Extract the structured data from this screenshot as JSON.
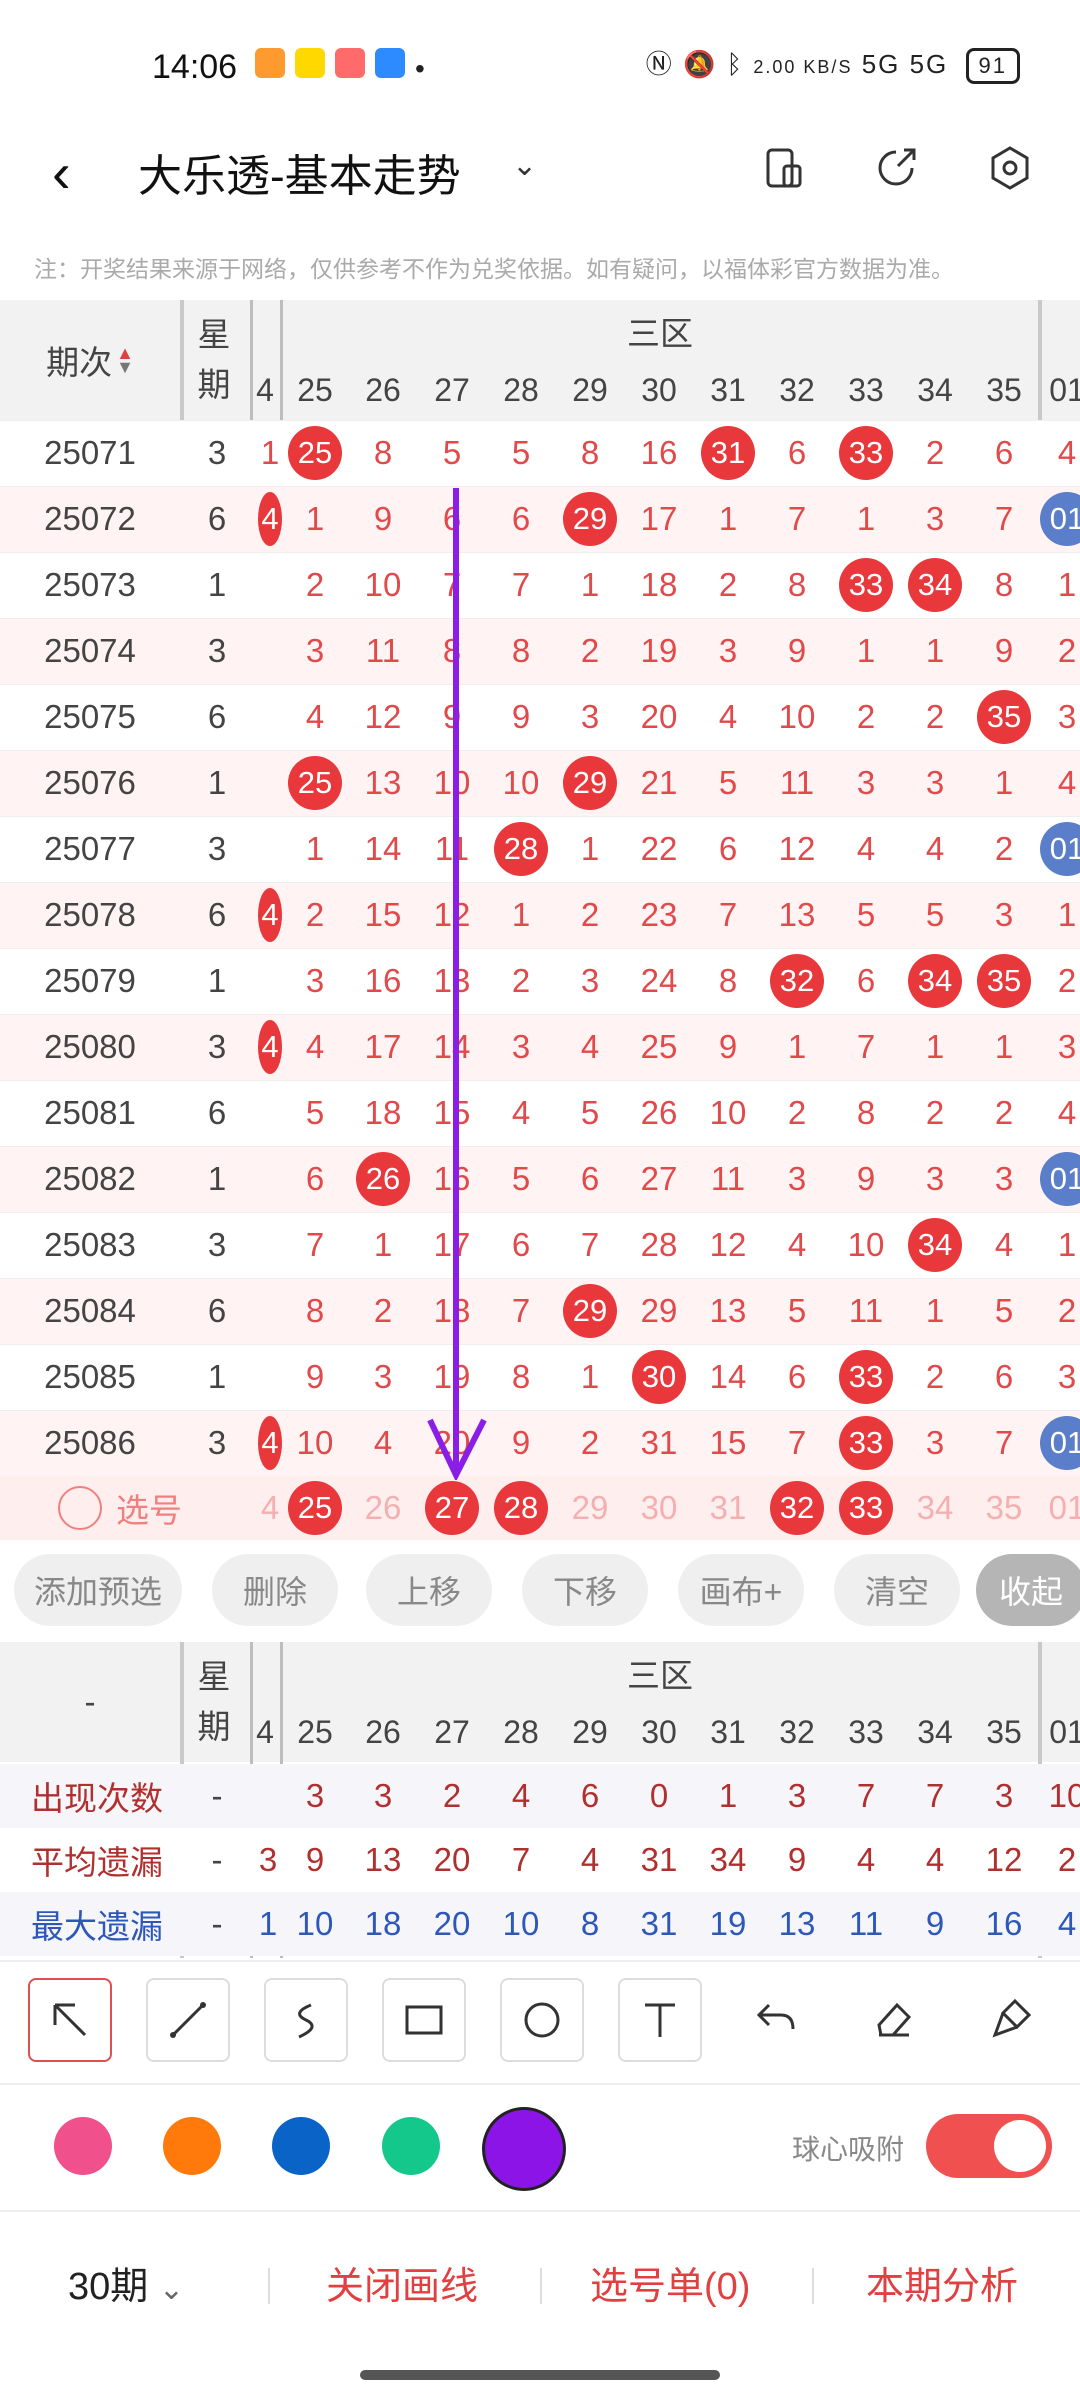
{
  "status": {
    "time": "14:06",
    "net_speed": "2.00 KB/S",
    "signal": "5G 5G",
    "battery": "91"
  },
  "header": {
    "title": "大乐透-基本走势"
  },
  "note": "注：开奖结果来源于网络，仅供参考不作为兑奖依据。如有疑问，以福体彩官方数据为准。",
  "table": {
    "col_issue": "期次",
    "col_week": "星期",
    "zone": "三区",
    "numbers": [
      "4",
      "25",
      "26",
      "27",
      "28",
      "29",
      "30",
      "31",
      "32",
      "33",
      "34",
      "35",
      "01"
    ],
    "rows": [
      {
        "issue": "25071",
        "week": "3",
        "vals": [
          "1",
          "25",
          "8",
          "5",
          "5",
          "8",
          "16",
          "31",
          "6",
          "33",
          "2",
          "6",
          "4"
        ]
      },
      {
        "issue": "25072",
        "week": "6",
        "vals": [
          "4",
          "1",
          "9",
          "6",
          "6",
          "29",
          "17",
          "1",
          "7",
          "1",
          "3",
          "7",
          "01"
        ]
      },
      {
        "issue": "25073",
        "week": "1",
        "vals": [
          "",
          "2",
          "10",
          "7",
          "7",
          "1",
          "18",
          "2",
          "8",
          "33",
          "34",
          "8",
          "1"
        ]
      },
      {
        "issue": "25074",
        "week": "3",
        "vals": [
          "",
          "3",
          "11",
          "8",
          "8",
          "2",
          "19",
          "3",
          "9",
          "1",
          "1",
          "9",
          "2"
        ]
      },
      {
        "issue": "25075",
        "week": "6",
        "vals": [
          "",
          "4",
          "12",
          "9",
          "9",
          "3",
          "20",
          "4",
          "10",
          "2",
          "2",
          "35",
          "3"
        ]
      },
      {
        "issue": "25076",
        "week": "1",
        "vals": [
          "",
          "25",
          "13",
          "10",
          "10",
          "29",
          "21",
          "5",
          "11",
          "3",
          "3",
          "1",
          "4"
        ]
      },
      {
        "issue": "25077",
        "week": "3",
        "vals": [
          "",
          "1",
          "14",
          "11",
          "28",
          "1",
          "22",
          "6",
          "12",
          "4",
          "4",
          "2",
          "01"
        ]
      },
      {
        "issue": "25078",
        "week": "6",
        "vals": [
          "4",
          "2",
          "15",
          "12",
          "1",
          "2",
          "23",
          "7",
          "13",
          "5",
          "5",
          "3",
          "1"
        ]
      },
      {
        "issue": "25079",
        "week": "1",
        "vals": [
          "",
          "3",
          "16",
          "13",
          "2",
          "3",
          "24",
          "8",
          "32",
          "6",
          "34",
          "35",
          "2"
        ]
      },
      {
        "issue": "25080",
        "week": "3",
        "vals": [
          "4",
          "4",
          "17",
          "14",
          "3",
          "4",
          "25",
          "9",
          "1",
          "7",
          "1",
          "1",
          "3"
        ]
      },
      {
        "issue": "25081",
        "week": "6",
        "vals": [
          "",
          "5",
          "18",
          "15",
          "4",
          "5",
          "26",
          "10",
          "2",
          "8",
          "2",
          "2",
          "4"
        ]
      },
      {
        "issue": "25082",
        "week": "1",
        "vals": [
          "",
          "6",
          "26",
          "16",
          "5",
          "6",
          "27",
          "11",
          "3",
          "9",
          "3",
          "3",
          "01"
        ]
      },
      {
        "issue": "25083",
        "week": "3",
        "vals": [
          "",
          "7",
          "1",
          "17",
          "6",
          "7",
          "28",
          "12",
          "4",
          "10",
          "34",
          "4",
          "1"
        ]
      },
      {
        "issue": "25084",
        "week": "6",
        "vals": [
          "",
          "8",
          "2",
          "18",
          "7",
          "29",
          "29",
          "13",
          "5",
          "11",
          "1",
          "5",
          "2"
        ]
      },
      {
        "issue": "25085",
        "week": "1",
        "vals": [
          "",
          "9",
          "3",
          "19",
          "8",
          "1",
          "30",
          "14",
          "6",
          "33",
          "2",
          "6",
          "3"
        ]
      },
      {
        "issue": "25086",
        "week": "3",
        "vals": [
          "4",
          "10",
          "4",
          "20",
          "9",
          "2",
          "31",
          "15",
          "7",
          "33",
          "3",
          "7",
          "01"
        ]
      }
    ],
    "select_label": "选号",
    "select_vals": [
      "4",
      "25",
      "26",
      "27",
      "28",
      "29",
      "30",
      "31",
      "32",
      "33",
      "34",
      "35",
      "01"
    ]
  },
  "actions": [
    "添加预选",
    "删除",
    "上移",
    "下移",
    "画布+",
    "清空",
    "收起"
  ],
  "stats": {
    "dash": "-",
    "col_week": "星期",
    "zone": "三区",
    "numbers": [
      "4",
      "25",
      "26",
      "27",
      "28",
      "29",
      "30",
      "31",
      "32",
      "33",
      "34",
      "35",
      "01"
    ],
    "rows": [
      {
        "label": "出现次数",
        "week": "-",
        "vals": [
          "",
          "3",
          "3",
          "2",
          "4",
          "6",
          "0",
          "1",
          "3",
          "7",
          "7",
          "3",
          "10"
        ]
      },
      {
        "label": "平均遗漏",
        "week": "-",
        "vals": [
          "3",
          "9",
          "13",
          "20",
          "7",
          "4",
          "31",
          "34",
          "9",
          "4",
          "4",
          "12",
          "2"
        ]
      },
      {
        "label": "最大遗漏",
        "week": "-",
        "vals": [
          "1",
          "10",
          "18",
          "20",
          "10",
          "8",
          "31",
          "19",
          "13",
          "11",
          "9",
          "16",
          "4"
        ]
      }
    ]
  },
  "palette": {
    "colors": [
      "#f0508c",
      "#ff7a0a",
      "#0a64c8",
      "#14c88c",
      "#8c14e6"
    ],
    "snap_label": "球心吸附",
    "snap_on": true
  },
  "bottom": {
    "period": "30期",
    "close_line": "关闭画线",
    "select_list": "选号单(0)",
    "analysis": "本期分析"
  }
}
